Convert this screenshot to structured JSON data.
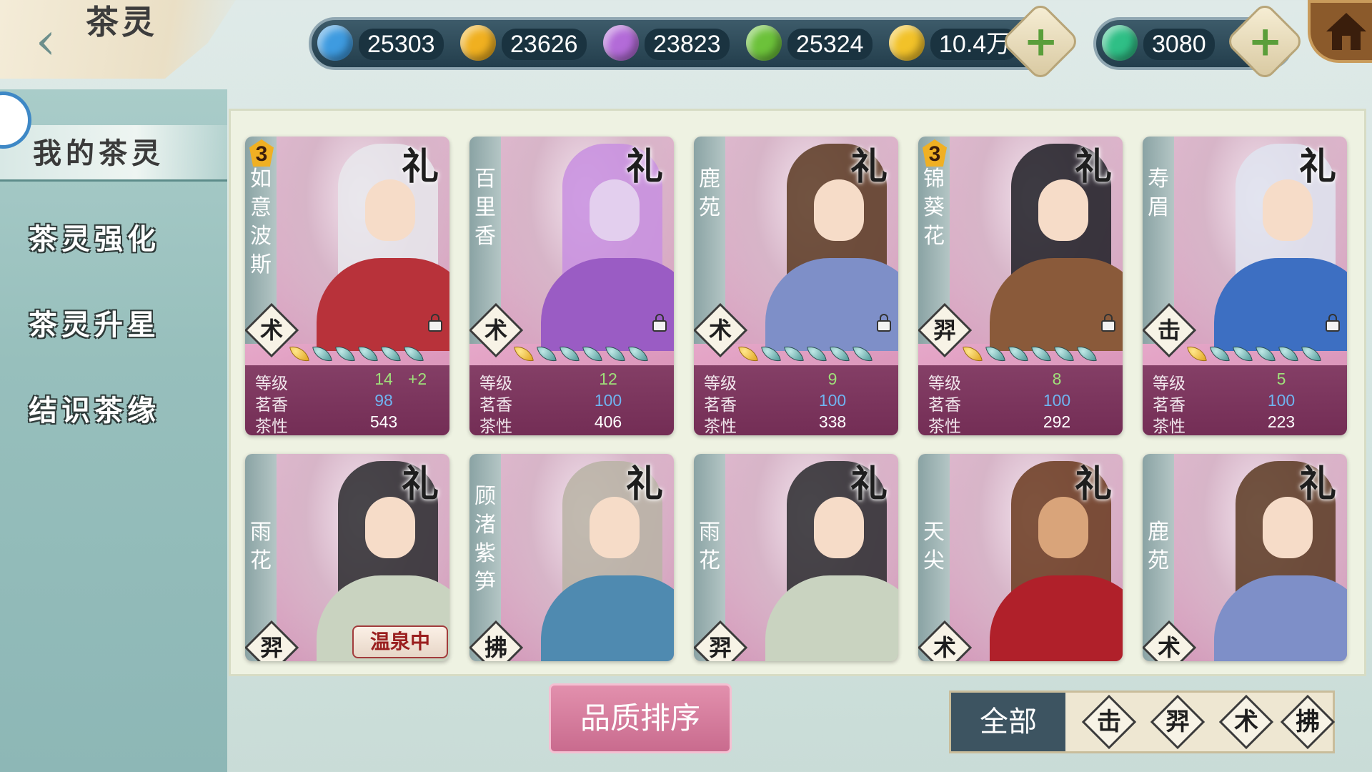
{
  "header": {
    "title": "茶灵",
    "back_icon": "back-chevron-icon",
    "home_icon": "home-icon"
  },
  "currencies": [
    {
      "name": "blue-gem-icon",
      "value": "25303",
      "color": "#3e9be0"
    },
    {
      "name": "gold-gem-icon",
      "value": "23626",
      "color": "#f0b020"
    },
    {
      "name": "purple-gem-icon",
      "value": "23823",
      "color": "#b36bd8"
    },
    {
      "name": "green-gem-icon",
      "value": "25324",
      "color": "#6cc23a"
    },
    {
      "name": "coin-icon",
      "value": "10.4万",
      "color": "#f2c229"
    }
  ],
  "special_currency": {
    "name": "jade-gem-icon",
    "value": "3080",
    "color": "#2fbf86"
  },
  "sidebar": {
    "items": [
      {
        "label": "我的茶灵",
        "active": true
      },
      {
        "label": "茶灵强化",
        "active": false
      },
      {
        "label": "茶灵升星",
        "active": false
      },
      {
        "label": "结识茶缘",
        "active": false
      }
    ]
  },
  "labels": {
    "level": "等级",
    "fragrance": "茗香",
    "nature": "茶性"
  },
  "cards": [
    {
      "name": "如意波斯",
      "star": "3",
      "tier": "礼",
      "type": "术",
      "level": "14",
      "bonus": "+2",
      "fragrance": "98",
      "nature": "543",
      "hair": "#e8e8ec",
      "robe": "#b8323a"
    },
    {
      "name": "百里香",
      "star": "",
      "tier": "礼",
      "type": "术",
      "level": "12",
      "bonus": "",
      "fragrance": "100",
      "nature": "406",
      "hair": "#c88fe0",
      "robe": "#9a5cc4"
    },
    {
      "name": "鹿苑",
      "star": "",
      "tier": "礼",
      "type": "术",
      "level": "9",
      "bonus": "",
      "fragrance": "100",
      "nature": "338",
      "hair": "#5a3a22",
      "robe": "#7e8fc8"
    },
    {
      "name": "锦葵花",
      "star": "3",
      "tier": "礼",
      "type": "羿",
      "level": "8",
      "bonus": "",
      "fragrance": "100",
      "nature": "292",
      "hair": "#1d1d24",
      "robe": "#8a5a3a"
    },
    {
      "name": "寿眉",
      "star": "",
      "tier": "礼",
      "type": "击",
      "level": "5",
      "bonus": "",
      "fragrance": "100",
      "nature": "223",
      "hair": "#dfe4f0",
      "robe": "#3d6fc2"
    },
    {
      "name": "雨花",
      "tier": "礼",
      "type": "羿",
      "status": "温泉中",
      "hair": "#2a2a2e",
      "robe": "#c9d3c0"
    },
    {
      "name": "顾渚紫笋",
      "tier": "礼",
      "type": "拂",
      "hair": "#b9b3a4",
      "robe": "#4f8ab0"
    },
    {
      "name": "雨花",
      "tier": "礼",
      "type": "羿",
      "hair": "#2a2a2e",
      "robe": "#c9d3c0"
    },
    {
      "name": "天尖",
      "tier": "礼",
      "type": "术",
      "hair": "#6a3a1e",
      "robe": "#b0202a"
    },
    {
      "name": "鹿苑",
      "tier": "礼",
      "type": "术",
      "hair": "#5a3a22",
      "robe": "#7e8fc8"
    }
  ],
  "bottom": {
    "sort_label": "品质排序",
    "filter_all_label": "全部",
    "filters": [
      "击",
      "羿",
      "术",
      "拂"
    ]
  }
}
